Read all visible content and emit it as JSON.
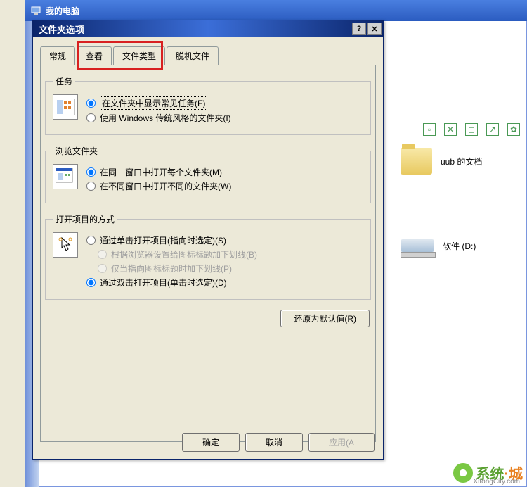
{
  "bg": {
    "title": "我的电脑",
    "files": [
      {
        "name": "uub 的文档",
        "type": "folder"
      },
      {
        "name": "软件 (D:)",
        "type": "drive"
      }
    ]
  },
  "dialog": {
    "title": "文件夹选项",
    "tabs": [
      "常规",
      "查看",
      "文件类型",
      "脱机文件"
    ],
    "active_tab": 0,
    "highlighted_tab": 1,
    "groups": {
      "tasks": {
        "legend": "任务",
        "opt1": "在文件夹中显示常见任务(F)",
        "opt2": "使用 Windows 传统风格的文件夹(I)"
      },
      "browse": {
        "legend": "浏览文件夹",
        "opt1": "在同一窗口中打开每个文件夹(M)",
        "opt2": "在不同窗口中打开不同的文件夹(W)"
      },
      "click": {
        "legend": "打开项目的方式",
        "opt1": "通过单击打开项目(指向时选定)(S)",
        "opt1a": "根据浏览器设置给图标标题加下划线(B)",
        "opt1b": "仅当指向图标标题时加下划线(P)",
        "opt2": "通过双击打开项目(单击时选定)(D)"
      }
    },
    "restore_btn": "还原为默认值(R)",
    "buttons": {
      "ok": "确定",
      "cancel": "取消",
      "apply": "应用(A"
    }
  },
  "watermark": {
    "text1": "系统",
    "text2": "城",
    "url": "XitongCity.com"
  }
}
